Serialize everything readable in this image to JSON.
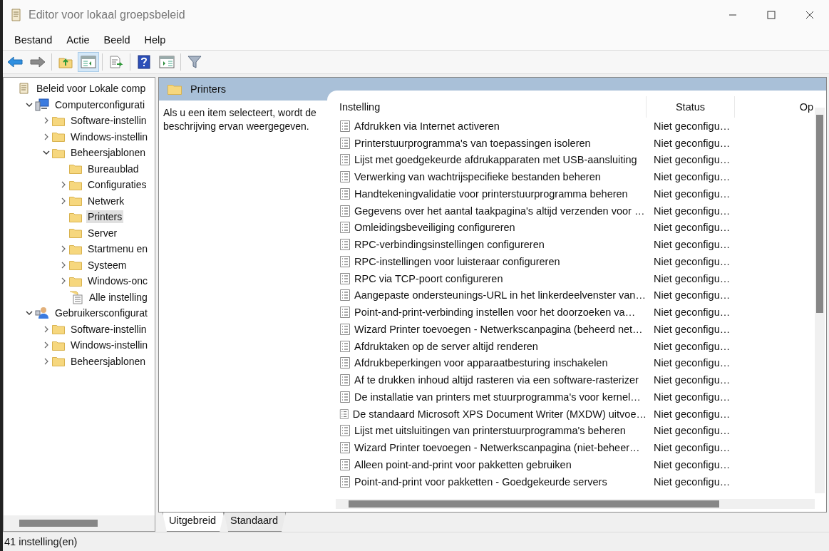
{
  "window": {
    "title": "Editor voor lokaal groepsbeleid"
  },
  "menu": [
    "Bestand",
    "Actie",
    "Beeld",
    "Help"
  ],
  "toolbar": [
    {
      "kind": "back",
      "pressed": false
    },
    {
      "kind": "forward",
      "pressed": false
    },
    {
      "kind": "up",
      "pressed": false
    },
    {
      "kind": "tree",
      "pressed": true
    },
    {
      "kind": "export",
      "pressed": false
    },
    {
      "kind": "help",
      "pressed": false
    },
    {
      "kind": "pane",
      "pressed": false
    },
    {
      "kind": "filter",
      "pressed": false
    }
  ],
  "tree": [
    {
      "label": "Beleid voor Lokale comp",
      "kind": "policy",
      "selected": false,
      "children": [
        {
          "label": "Computerconfigurati",
          "kind": "computer",
          "expanded": true,
          "selected": false,
          "children": [
            {
              "label": "Software-instellin",
              "kind": "folder",
              "expanded": false,
              "selected": false
            },
            {
              "label": "Windows-instellin",
              "kind": "folder",
              "expanded": false,
              "selected": false
            },
            {
              "label": "Beheersjablonen",
              "kind": "folder",
              "expanded": true,
              "selected": false,
              "children": [
                {
                  "label": "Bureaublad",
                  "kind": "folder",
                  "selected": false
                },
                {
                  "label": "Configuraties",
                  "kind": "folder",
                  "expanded": false,
                  "selected": false
                },
                {
                  "label": "Netwerk",
                  "kind": "folder",
                  "expanded": false,
                  "selected": false
                },
                {
                  "label": "Printers",
                  "kind": "folder",
                  "selected": true
                },
                {
                  "label": "Server",
                  "kind": "folder",
                  "selected": false
                },
                {
                  "label": "Startmenu en",
                  "kind": "folder",
                  "expanded": false,
                  "selected": false
                },
                {
                  "label": "Systeem",
                  "kind": "folder",
                  "expanded": false,
                  "selected": false
                },
                {
                  "label": "Windows-onc",
                  "kind": "folder",
                  "expanded": false,
                  "selected": false
                },
                {
                  "label": "Alle instelling",
                  "kind": "settings",
                  "selected": false
                }
              ]
            }
          ]
        },
        {
          "label": "Gebruikersconfigurat",
          "kind": "user",
          "expanded": true,
          "selected": false,
          "children": [
            {
              "label": "Software-instellin",
              "kind": "folder",
              "expanded": false,
              "selected": false
            },
            {
              "label": "Windows-instellin",
              "kind": "folder",
              "expanded": false,
              "selected": false
            },
            {
              "label": "Beheersjablonen",
              "kind": "folder",
              "expanded": false,
              "selected": false
            }
          ]
        }
      ]
    }
  ],
  "panel": {
    "title": "Printers",
    "description": "Als u een item selecteert, wordt de beschrijving ervan weergegeven."
  },
  "table": {
    "columns": [
      "Instelling",
      "Status",
      "Op"
    ],
    "rows": [
      {
        "setting": "Afdrukken via Internet activeren",
        "status": "Niet geconfigu…"
      },
      {
        "setting": "Printerstuurprogramma's van toepassingen isoleren",
        "status": "Niet geconfigu…"
      },
      {
        "setting": "Lijst met goedgekeurde afdrukapparaten met USB-aansluiting",
        "status": "Niet geconfigu…"
      },
      {
        "setting": "Verwerking van wachtrijspecifieke bestanden beheren",
        "status": "Niet geconfigu…"
      },
      {
        "setting": "Handtekeningvalidatie voor printerstuurprogramma beheren",
        "status": "Niet geconfigu…"
      },
      {
        "setting": "Gegevens over het aantal taakpagina's altijd verzenden voor …",
        "status": "Niet geconfigu…"
      },
      {
        "setting": "Omleidingsbeveiliging configureren",
        "status": "Niet geconfigu…"
      },
      {
        "setting": "RPC-verbindingsinstellingen configureren",
        "status": "Niet geconfigu…"
      },
      {
        "setting": "RPC-instellingen voor luisteraar configureren",
        "status": "Niet geconfigu…"
      },
      {
        "setting": "RPC via TCP-poort configureren",
        "status": "Niet geconfigu…"
      },
      {
        "setting": "Aangepaste ondersteunings-URL in het linkerdeelvenster van…",
        "status": "Niet geconfigu…"
      },
      {
        "setting": "Point-and-print-verbinding instellen voor het doorzoeken va…",
        "status": "Niet geconfigu…"
      },
      {
        "setting": "Wizard Printer toevoegen - Netwerkscanpagina (beheerd net…",
        "status": "Niet geconfigu…"
      },
      {
        "setting": "Afdruktaken op de server altijd renderen",
        "status": "Niet geconfigu…"
      },
      {
        "setting": "Afdrukbeperkingen voor apparaatbesturing inschakelen",
        "status": "Niet geconfigu…"
      },
      {
        "setting": "Af te drukken inhoud altijd rasteren via een software-rasterizer",
        "status": "Niet geconfigu…"
      },
      {
        "setting": "De installatie van printers met stuurprogramma's voor kernel…",
        "status": "Niet geconfigu…"
      },
      {
        "setting": "De standaard Microsoft XPS Document Writer (MXDW) uitvoe…",
        "status": "Niet geconfigu…"
      },
      {
        "setting": "Lijst met uitsluitingen van printerstuurprogramma's beheren",
        "status": "Niet geconfigu…"
      },
      {
        "setting": "Wizard Printer toevoegen - Netwerkscanpagina (niet-beheer…",
        "status": "Niet geconfigu…"
      },
      {
        "setting": "Alleen point-and-print voor pakketten gebruiken",
        "status": "Niet geconfigu…"
      },
      {
        "setting": "Point-and-print voor pakketten - Goedgekeurde servers",
        "status": "Niet geconfigu…"
      }
    ]
  },
  "tabs": [
    {
      "label": "Uitgebreid",
      "selected": true
    },
    {
      "label": "Standaard",
      "selected": false
    }
  ],
  "status_bar": "41 instelling(en)"
}
